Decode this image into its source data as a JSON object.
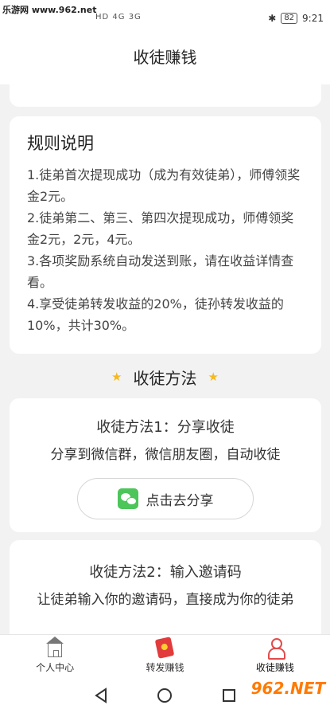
{
  "status": {
    "watermark": "乐游网 www.962.net",
    "signals": "HD 4G 3G",
    "battery": "82",
    "time": "9:21"
  },
  "header": {
    "title": "收徒赚钱"
  },
  "rules": {
    "title": "规则说明",
    "items": [
      "1.徒弟首次提现成功（成为有效徒弟），师傅领奖金2元。",
      "2.徒弟第二、第三、第四次提现成功，师傅领奖金2元，2元，4元。",
      "3.各项奖励系统自动发送到账，请在收益详情查看。",
      "4.享受徒弟转发收益的20%，徒孙转发收益的10%，共计30%。"
    ]
  },
  "section": {
    "title": "收徒方法",
    "star": "★"
  },
  "method1": {
    "title": "收徒方法1：分享收徒",
    "desc": "分享到微信群，微信朋友圈，自动收徒",
    "button": "点击去分享"
  },
  "method2": {
    "title": "收徒方法2：输入邀请码",
    "desc": "让徒弟输入你的邀请码，直接成为你的徒弟"
  },
  "tabs": [
    {
      "label": "个人中心",
      "icon": "home-icon"
    },
    {
      "label": "转发赚钱",
      "icon": "red-packet-icon"
    },
    {
      "label": "收徒赚钱",
      "icon": "person-icon"
    }
  ],
  "watermark2": "962.NET",
  "colors": {
    "accent": "#f5b921",
    "wechat": "#4cc55a",
    "active_icon": "#e24b4b"
  }
}
